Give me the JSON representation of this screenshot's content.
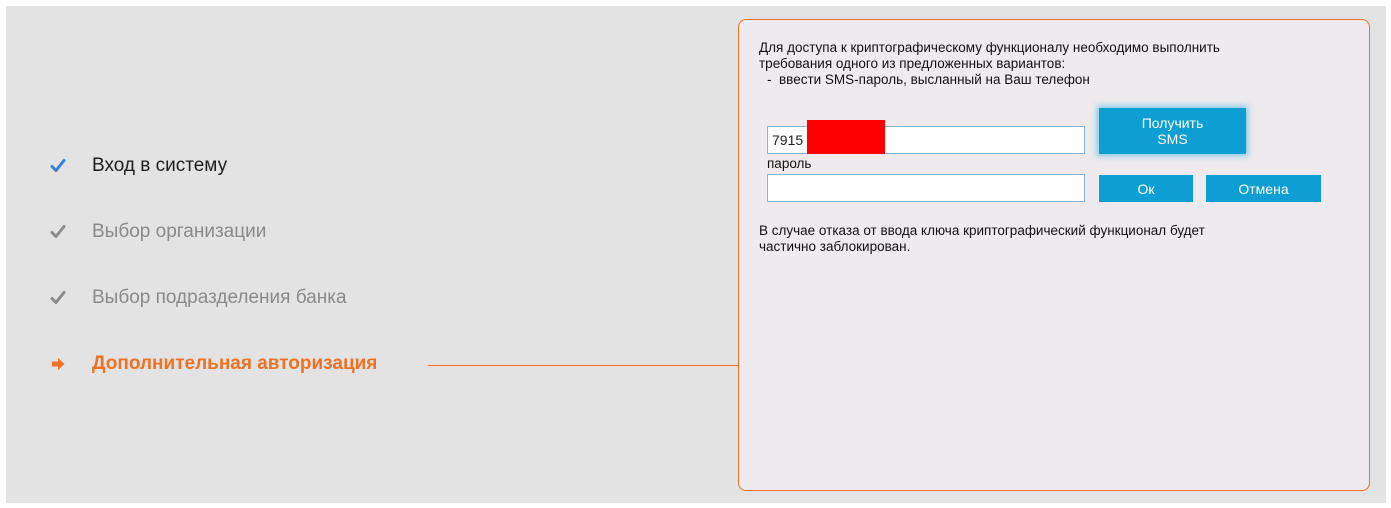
{
  "steps": [
    {
      "label": "Вход в систему",
      "state": "done",
      "icon": "check-blue-icon"
    },
    {
      "label": "Выбор организации",
      "state": "pending",
      "icon": "check-gray-icon"
    },
    {
      "label": "Выбор подразделения банка",
      "state": "pending",
      "icon": "check-gray-icon"
    },
    {
      "label": "Дополнительная авторизация",
      "state": "current",
      "icon": "arrow-right-icon"
    }
  ],
  "colors": {
    "accent": "#ee7224",
    "button": "#0d9fd3",
    "panel_bg": "#eeeaed",
    "page_bg": "#e3e3e3"
  },
  "dialog": {
    "intro_line1": "Для доступа к криптографическому функционалу необходимо выполнить",
    "intro_line2": "требования одного из предложенных вариантов:",
    "option": "-  ввести SMS-пароль, высланный на Ваш телефон",
    "phone_value": "7915",
    "password_label": "пароль",
    "password_value": "",
    "sms_button_line1": "Получить",
    "sms_button_line2": "SMS",
    "ok_button": "Ок",
    "cancel_button": "Отмена",
    "note_line1": "В случае отказа от ввода ключа криптографический функционал будет",
    "note_line2": "частично заблокирован."
  }
}
